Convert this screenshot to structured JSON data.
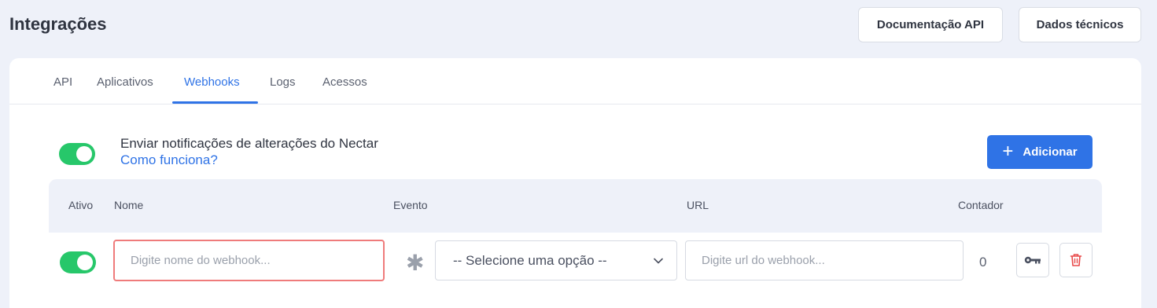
{
  "header": {
    "title": "Integrações",
    "doc_button": "Documentação API",
    "dados_button": "Dados técnicos"
  },
  "tabs": [
    {
      "label": "API",
      "active": false
    },
    {
      "label": "Aplicativos",
      "active": false
    },
    {
      "label": "Webhooks",
      "active": true
    },
    {
      "label": "Logs",
      "active": false
    },
    {
      "label": "Acessos",
      "active": false
    }
  ],
  "notifications": {
    "enabled": true,
    "text": "Enviar notificações de alterações do Nectar",
    "help_link": "Como funciona?"
  },
  "add_button": {
    "label": "Adicionar",
    "icon": "plus-icon"
  },
  "table": {
    "columns": {
      "ativo": "Ativo",
      "nome": "Nome",
      "evento": "Evento",
      "url": "URL",
      "contador": "Contador"
    },
    "row": {
      "active": true,
      "name_placeholder": "Digite nome do webhook...",
      "required_marker": "✱",
      "event_selected": "-- Selecione uma opção --",
      "url_placeholder": "Digite url do webhook...",
      "counter": "0",
      "key_icon": "key-icon",
      "delete_icon": "trash-icon"
    }
  },
  "colors": {
    "accent": "#2f73e6",
    "toggle_on": "#27c76a",
    "error_border": "#ef7b7b",
    "delete": "#e84a4a"
  }
}
